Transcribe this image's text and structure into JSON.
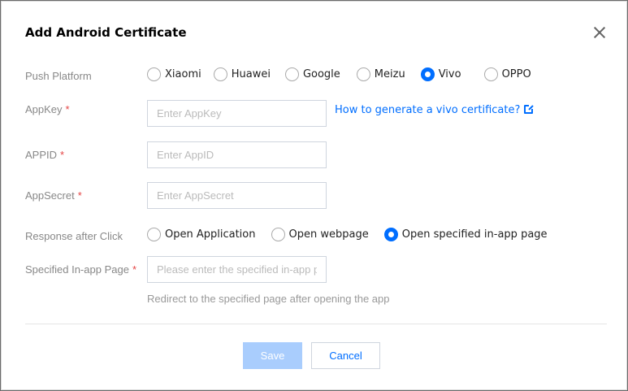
{
  "dialog": {
    "title": "Add Android Certificate"
  },
  "form": {
    "push_platform": {
      "label": "Push Platform",
      "options": [
        "Xiaomi",
        "Huawei",
        "Google",
        "Meizu",
        "Vivo",
        "OPPO"
      ],
      "selected": "Vivo"
    },
    "appkey": {
      "label": "AppKey",
      "placeholder": "Enter AppKey",
      "value": ""
    },
    "appid": {
      "label": "APPID",
      "placeholder": "Enter AppID",
      "value": ""
    },
    "appsecret": {
      "label": "AppSecret",
      "placeholder": "Enter AppSecret",
      "value": ""
    },
    "help_link": "How to generate a vivo certificate?",
    "required_mark": "*",
    "response": {
      "label": "Response after Click",
      "options": [
        "Open Application",
        "Open webpage",
        "Open specified in-app page"
      ],
      "selected": "Open specified in-app page"
    },
    "inapp_page": {
      "label": "Specified In-app Page",
      "placeholder": "Please enter the specified in-app page",
      "value": "",
      "hint": "Redirect to the specified page after opening the app"
    }
  },
  "footer": {
    "save_label": "Save",
    "cancel_label": "Cancel"
  },
  "colors": {
    "accent": "#006eff",
    "required": "#e54545",
    "disabled_button": "#a9cdfd"
  }
}
